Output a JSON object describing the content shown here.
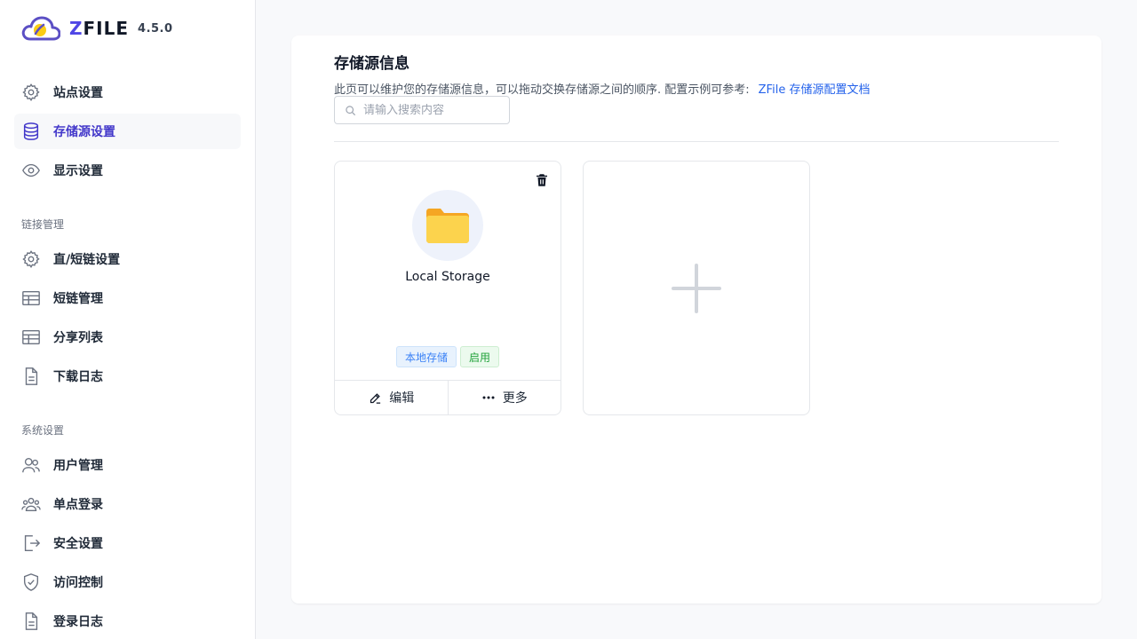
{
  "app": {
    "logo_text_z": "Z",
    "logo_text_rest": "FILE",
    "version": "4.5.0"
  },
  "sidebar": {
    "items_top": [
      {
        "label": "站点设置",
        "icon": "gear-icon"
      },
      {
        "label": "存储源设置",
        "icon": "database-icon",
        "active": true
      },
      {
        "label": "显示设置",
        "icon": "eye-icon"
      }
    ],
    "section_links": "链接管理",
    "items_links": [
      {
        "label": "直/短链设置",
        "icon": "gear-icon"
      },
      {
        "label": "短链管理",
        "icon": "table-icon"
      },
      {
        "label": "分享列表",
        "icon": "table-icon"
      },
      {
        "label": "下载日志",
        "icon": "document-icon"
      }
    ],
    "section_system": "系统设置",
    "items_system": [
      {
        "label": "用户管理",
        "icon": "users-icon"
      },
      {
        "label": "单点登录",
        "icon": "user-group-icon"
      },
      {
        "label": "安全设置",
        "icon": "logout-icon"
      },
      {
        "label": "访问控制",
        "icon": "shield-check-icon"
      },
      {
        "label": "登录日志",
        "icon": "document-icon"
      }
    ]
  },
  "main": {
    "title": "存储源信息",
    "description": "此页可以维护您的存储源信息，可以拖动交换存储源之间的顺序. 配置示例可参考:",
    "doc_link": "ZFile 存储源配置文档",
    "search_placeholder": "请输入搜索内容",
    "search_value": "",
    "storages": [
      {
        "name": "Local Storage",
        "type_tag": "本地存储",
        "status_tag": "启用",
        "edit_label": "编辑",
        "more_label": "更多"
      }
    ]
  },
  "colors": {
    "accent": "#4338ca",
    "link": "#2563eb",
    "folder": "#fbbf24"
  }
}
